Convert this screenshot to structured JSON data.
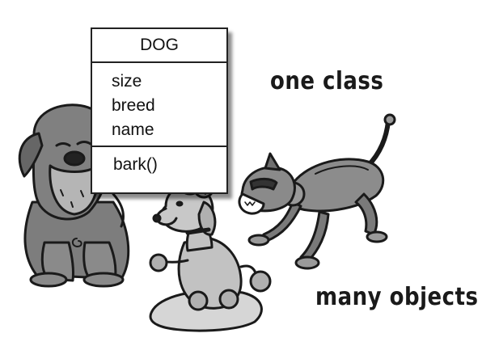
{
  "class_box": {
    "name": "DOG",
    "attributes": [
      "size",
      "breed",
      "name"
    ],
    "methods": [
      "bark()"
    ]
  },
  "labels": {
    "one_class": "one class",
    "many_objects": "many objects"
  },
  "illustrations": [
    "bulldog-illustration",
    "poodle-illustration",
    "robot-dog-illustration"
  ]
}
